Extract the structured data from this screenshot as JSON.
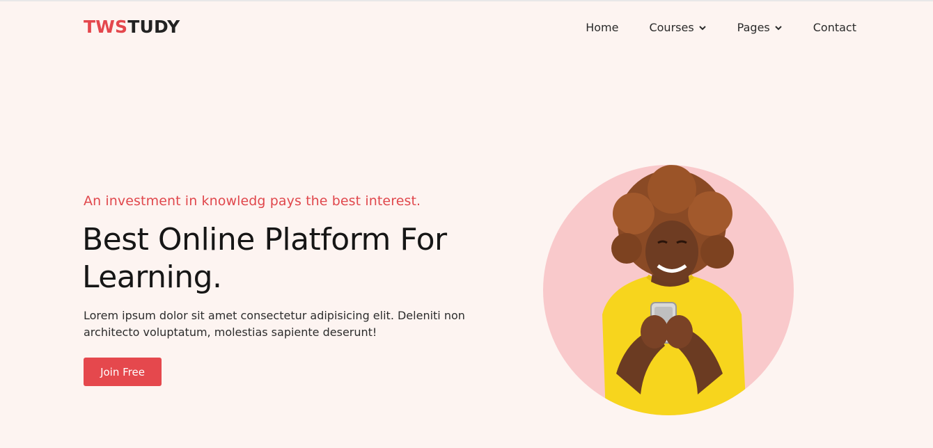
{
  "header": {
    "logo_accent": "TWS",
    "logo_rest": "TUDY",
    "nav": [
      {
        "label": "Home",
        "has_dropdown": false
      },
      {
        "label": "Courses",
        "has_dropdown": true
      },
      {
        "label": "Pages",
        "has_dropdown": true
      },
      {
        "label": "Contact",
        "has_dropdown": false
      }
    ]
  },
  "hero": {
    "tagline": "An investment in knowledg pays the best interest.",
    "headline_line1": "Best Online Platform For",
    "headline_line2": "Learning.",
    "description": "Lorem ipsum dolor sit amet consectetur adipisicing elit. Deleniti non architecto voluptatum, molestias sapiente deserunt!",
    "cta_label": "Join Free",
    "image_alt": "hero-photo-woman-with-phone"
  },
  "colors": {
    "background": "#fdf4f1",
    "accent": "#e5484d",
    "circle": "#f9c9cb",
    "shirt": "#f7d51d"
  }
}
